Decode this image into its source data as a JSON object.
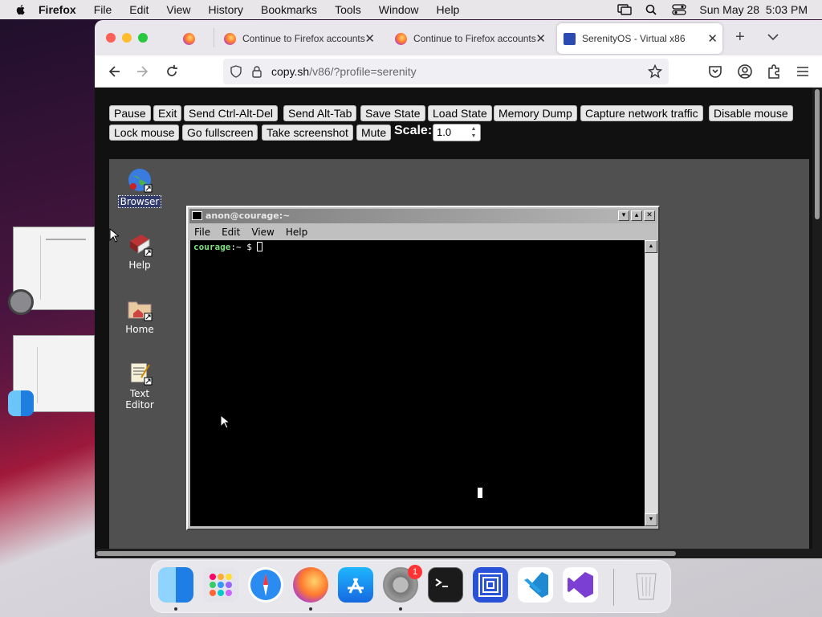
{
  "menubar": {
    "app": "Firefox",
    "menus": [
      "File",
      "Edit",
      "View",
      "History",
      "Bookmarks",
      "Tools",
      "Window",
      "Help"
    ],
    "clock": "Sun May 28  5:03 PM"
  },
  "tabs": [
    {
      "title": "Continue to Firefox accounts",
      "active": false
    },
    {
      "title": "Continue to Firefox accounts",
      "active": false
    },
    {
      "title": "SerenityOS - Virtual x86",
      "active": true
    }
  ],
  "url": {
    "domain": "copy.sh",
    "path": "/v86/?profile=serenity"
  },
  "v86_buttons": {
    "row1": [
      "Pause",
      "Exit",
      "Send Ctrl-Alt-Del",
      "Send Alt-Tab",
      "Save State",
      "Load State",
      "Memory Dump",
      "Capture network traffic",
      "Disable mouse"
    ],
    "row2": [
      "Lock mouse",
      "Go fullscreen",
      "Take screenshot",
      "Mute"
    ],
    "scale_label": "Scale:",
    "scale_value": "1.0"
  },
  "desktop_icons": [
    {
      "label": "Browser",
      "selected": true
    },
    {
      "label": "Help",
      "selected": false
    },
    {
      "label": "Home",
      "selected": false
    },
    {
      "label": "Text Editor",
      "selected": false
    }
  ],
  "terminal": {
    "title": "anon@courage:~",
    "menus": [
      "File",
      "Edit",
      "View",
      "Help"
    ],
    "prompt_host": "courage",
    "prompt_rest": ":~ $ "
  },
  "dock": {
    "apps": [
      "finder",
      "launchpad",
      "safari",
      "firefox",
      "app-store",
      "system-settings",
      "terminal",
      "remote-desktop",
      "vscode",
      "visual-studio",
      "trash"
    ],
    "settings_badge": "1"
  },
  "colors": {
    "accent": "#1d6ff2",
    "terminal_host": "#7fe07f"
  }
}
